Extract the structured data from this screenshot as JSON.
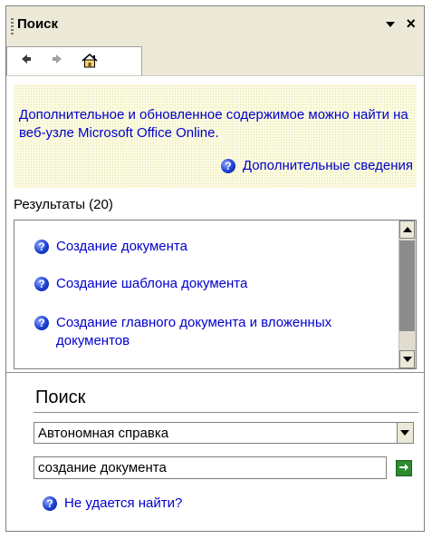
{
  "pane": {
    "title": "Поиск",
    "dropdown_icon": "chevron-down-icon",
    "close_label": "×"
  },
  "nav": {
    "back_icon": "back-arrow-icon",
    "forward_icon": "forward-arrow-icon",
    "home_icon": "home-icon"
  },
  "info": {
    "text": "Дополнительное и обновленное содержимое можно найти на веб-узле Microsoft Office Online.",
    "more_link": "Дополнительные сведения"
  },
  "results": {
    "label": "Результаты (20)",
    "items": [
      "Создание документа",
      "Создание шаблона документа",
      "Создание главного документа и вложенных документов"
    ]
  },
  "search": {
    "heading": "Поиск",
    "scope_selected": "Автономная справка",
    "query_value": "создание документа",
    "go_icon": "go-arrow-icon",
    "cant_find_link": "Не удается найти?"
  },
  "colors": {
    "link": "#0000cc",
    "info_background": "#fbfbe4",
    "go_button": "#2e8b2e"
  }
}
